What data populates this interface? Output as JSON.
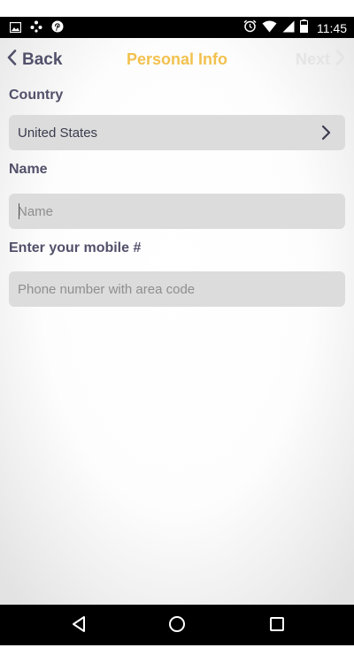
{
  "status_bar": {
    "time": "11:45",
    "left_icons": [
      "image-icon",
      "dots-icon",
      "pinterest-icon"
    ],
    "right_icons": [
      "alarm-icon",
      "wifi-icon",
      "signal-icon",
      "battery-icon"
    ]
  },
  "header": {
    "back_label": "Back",
    "title": "Personal Info",
    "next_label": "Next"
  },
  "form": {
    "country_label": "Country",
    "country_value": "United States",
    "name_label": "Name",
    "name_placeholder": "Name",
    "mobile_label": "Enter your mobile #",
    "mobile_placeholder": "Phone number with area code"
  },
  "nav_bar": {
    "buttons": [
      "back-triangle-icon",
      "home-circle-icon",
      "recents-square-icon"
    ]
  },
  "colors": {
    "title_accent": "#f2c14e",
    "label_text": "#52506a",
    "field_background": "#dcdcdc",
    "disabled_text": "#e4e4e4"
  }
}
